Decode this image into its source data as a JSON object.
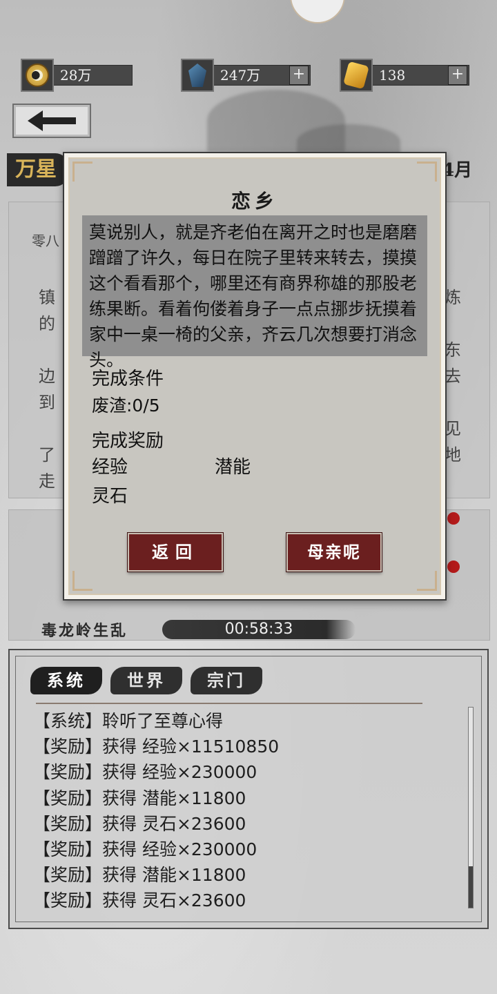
{
  "resources": [
    {
      "icon": "taiji-coin-icon",
      "value": "28万",
      "has_plus": false
    },
    {
      "icon": "blue-crystal-icon",
      "value": "247万",
      "has_plus": true
    },
    {
      "icon": "gold-ingot-icon",
      "value": "138",
      "has_plus": true
    }
  ],
  "background_page": {
    "title_partial": "万星",
    "month_partial": "4月",
    "subtitle_partial": "零八",
    "text_fragments": [
      "镇",
      "的",
      "边",
      "到",
      "了",
      "走",
      "炼",
      "东",
      "去",
      "见",
      "地"
    ],
    "event_name": "毒龙岭生乱",
    "event_timer": "00:58:33"
  },
  "dialog": {
    "title": "恋乡",
    "story": "莫说别人，就是齐老伯在离开之时也是磨磨蹭蹭了许久，每日在院子里转来转去，摸摸这个看看那个，哪里还有商界称雄的那股老练果断。看着佝偻着身子一点点挪步抚摸着家中一桌一椅的父亲，齐云几次想要打消念头。",
    "condition_label": "完成条件",
    "condition_value": "废渣:0/5",
    "reward_label": "完成奖励",
    "rewards": [
      "经验",
      "潜能",
      "灵石"
    ],
    "back_button": "返回",
    "choice_button": "母亲呢"
  },
  "chat": {
    "tabs": [
      "系统",
      "世界",
      "宗门"
    ],
    "messages": [
      "【系统】聆听了至尊心得",
      "【奖励】获得 经验×11510850",
      "【奖励】获得 经验×230000",
      "【奖励】获得 潜能×11800",
      "【奖励】获得 灵石×23600",
      "【奖励】获得 经验×230000",
      "【奖励】获得 潜能×11800",
      "【奖励】获得 灵石×23600"
    ]
  }
}
